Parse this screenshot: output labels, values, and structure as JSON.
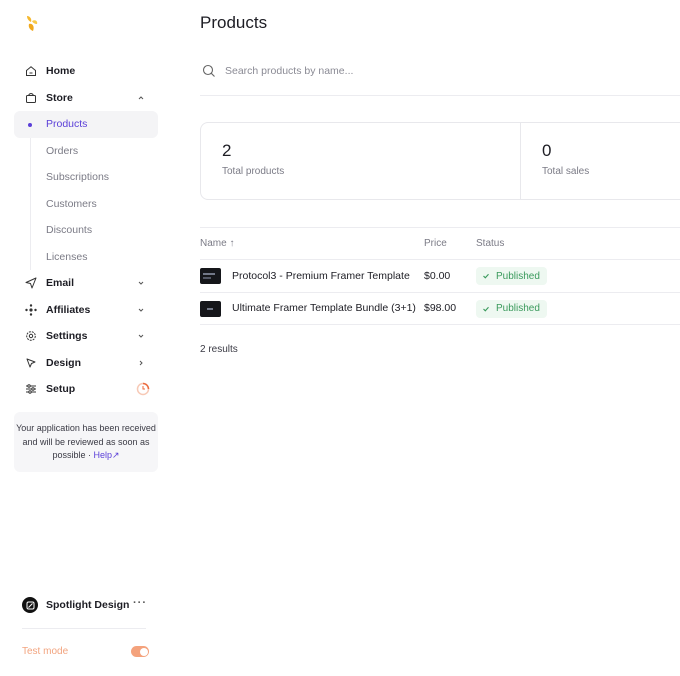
{
  "sidebar": {
    "items": [
      {
        "label": "Home",
        "icon": "home-icon"
      },
      {
        "label": "Store",
        "icon": "bag-icon"
      },
      {
        "label": "Email",
        "icon": "send-icon"
      },
      {
        "label": "Affiliates",
        "icon": "affiliates-icon"
      },
      {
        "label": "Settings",
        "icon": "gear-icon"
      },
      {
        "label": "Design",
        "icon": "cursor-icon"
      },
      {
        "label": "Setup",
        "icon": "sliders-icon"
      }
    ],
    "store_sub": [
      "Products",
      "Orders",
      "Subscriptions",
      "Customers",
      "Discounts",
      "Licenses"
    ],
    "notice": {
      "text": "Your application has been received and will be reviewed as soon as possible ·",
      "help": "Help"
    },
    "account": {
      "name": "Spotlight Design",
      "more": "···"
    },
    "test_mode": {
      "label": "Test mode",
      "enabled": true
    }
  },
  "main": {
    "title": "Products",
    "search": {
      "placeholder": "Search products by name..."
    },
    "stats": [
      {
        "value": "2",
        "label": "Total products"
      },
      {
        "value": "0",
        "label": "Total sales"
      }
    ],
    "table": {
      "headers": {
        "name": "Name ↑",
        "price": "Price",
        "status": "Status"
      },
      "rows": [
        {
          "name": "Protocol3 - Premium Framer Template",
          "price": "$0.00",
          "status": "Published"
        },
        {
          "name": "Ultimate Framer Template Bundle (3+1)",
          "price": "$98.00",
          "status": "Published"
        }
      ]
    },
    "results": "2 results"
  },
  "colors": {
    "accent": "#5b3fd8",
    "published_bg": "#eef8f1",
    "published_text": "#3a9a5c",
    "logo": "#f5b82e",
    "test_mode": "#f4a27c"
  }
}
